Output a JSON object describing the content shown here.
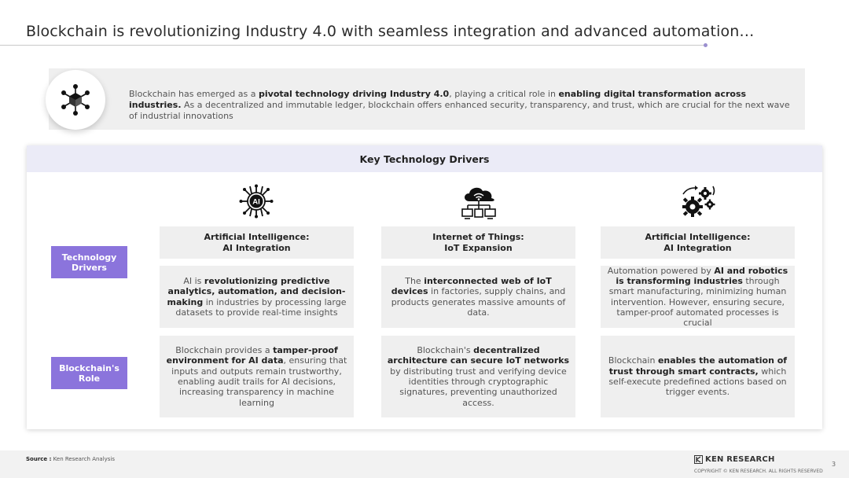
{
  "title": "Blockchain is revolutionizing Industry 4.0 with seamless integration and advanced automation…",
  "intro": {
    "icon": "blockchain-cube-icon",
    "parts": [
      {
        "text": "Blockchain has emerged as a ",
        "bold": false
      },
      {
        "text": "pivotal technology driving Industry 4.0",
        "bold": true
      },
      {
        "text": ", playing a critical role in ",
        "bold": false
      },
      {
        "text": "enabling digital transformation across industries.",
        "bold": true
      },
      {
        "text": " As a decentralized and immutable ledger, blockchain offers enhanced security, transparency, and trust, which are crucial for the next wave of industrial innovations",
        "bold": false
      }
    ]
  },
  "panel_title": "Key Technology Drivers",
  "row_labels": {
    "drivers": "Technology Drivers",
    "role": "Blockchain's Role"
  },
  "columns": [
    {
      "icon": "ai-chip-icon",
      "icon_text": "AI",
      "heading_line1": "Artificial Intelligence:",
      "heading_line2": "AI Integration",
      "driver": [
        {
          "text": "AI is ",
          "bold": false
        },
        {
          "text": "revolutionizing predictive analytics, automation, and decision-making",
          "bold": true
        },
        {
          "text": " in industries by processing large datasets to provide real-time insights",
          "bold": false
        }
      ],
      "role": [
        {
          "text": "Blockchain provides a ",
          "bold": false
        },
        {
          "text": "tamper-proof environment for AI data",
          "bold": true
        },
        {
          "text": ", ensuring that inputs and outputs remain trustworthy, enabling audit trails for AI decisions, increasing transparency in machine learning",
          "bold": false
        }
      ]
    },
    {
      "icon": "cloud-devices-icon",
      "heading_line1": "Internet of Things:",
      "heading_line2": "IoT Expansion",
      "driver": [
        {
          "text": "The ",
          "bold": false
        },
        {
          "text": "interconnected web of IoT devices",
          "bold": true
        },
        {
          "text": " in factories, supply chains, and products generates massive amounts of data.",
          "bold": false
        }
      ],
      "role": [
        {
          "text": "Blockchain's ",
          "bold": false
        },
        {
          "text": "decentralized architecture can secure IoT networks",
          "bold": true
        },
        {
          "text": " by distributing trust and verifying device identities through cryptographic signatures, preventing unauthorized access.",
          "bold": false
        }
      ]
    },
    {
      "icon": "gears-automation-icon",
      "heading_line1": "Artificial Intelligence:",
      "heading_line2": "AI Integration",
      "driver": [
        {
          "text": "Automation powered by ",
          "bold": false
        },
        {
          "text": "AI and robotics is transforming industries",
          "bold": true
        },
        {
          "text": " through smart manufacturing, minimizing human intervention. However, ensuring secure, tamper-proof automated processes is crucial",
          "bold": false
        }
      ],
      "role": [
        {
          "text": "Blockchain ",
          "bold": false
        },
        {
          "text": "enables the automation of trust through smart contracts,",
          "bold": true
        },
        {
          "text": " which self-execute predefined actions based on trigger events.",
          "bold": false
        }
      ]
    }
  ],
  "footer": {
    "source_label": "Source :",
    "source_text": "Ken Research Analysis",
    "brand": "KEN RESEARCH",
    "copyright": "COPYRIGHT © KEN RESEARCH. ALL RIGHTS RESERVED",
    "page_number": "3"
  },
  "colors": {
    "accent_purple": "#8b74dc",
    "panel_header_bg": "#ebebf7",
    "cell_bg": "#efefef"
  }
}
